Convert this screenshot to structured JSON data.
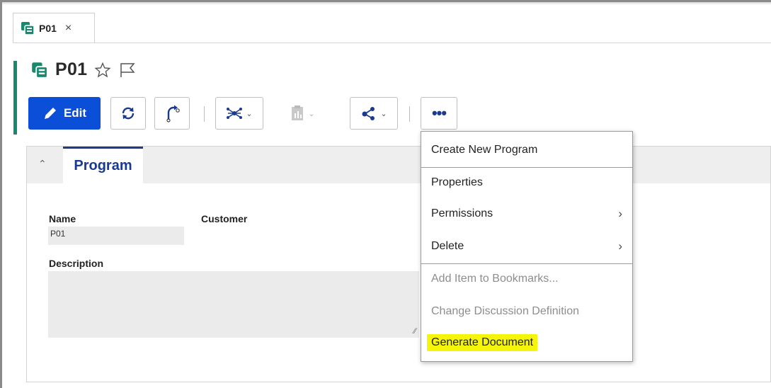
{
  "tab": {
    "label": "P01",
    "close": "×"
  },
  "title": {
    "text": "P01"
  },
  "toolbar": {
    "edit_label": "Edit",
    "more_label": "•••"
  },
  "section": {
    "tab_label": "Program"
  },
  "form": {
    "name_label": "Name",
    "name_value": "P01",
    "customer_label": "Customer",
    "description_label": "Description",
    "description_value": ""
  },
  "menu": {
    "items": [
      {
        "label": "Create New Program",
        "submenu": false,
        "enabled": true
      },
      {
        "label": "Properties",
        "submenu": false,
        "enabled": true
      },
      {
        "label": "Permissions",
        "submenu": true,
        "enabled": true
      },
      {
        "label": "Delete",
        "submenu": true,
        "enabled": true
      },
      {
        "label": "Add Item to Bookmarks...",
        "submenu": false,
        "enabled": false
      },
      {
        "label": "Change Discussion Definition",
        "submenu": false,
        "enabled": false
      },
      {
        "label": "Generate Document",
        "submenu": false,
        "enabled": true,
        "highlighted": true
      }
    ]
  },
  "colors": {
    "accent_green": "#17896f",
    "edit_blue": "#0b4ed8",
    "tab_blue": "#1a3a8f",
    "highlight_yellow": "#f5f50a"
  },
  "icons": [
    "program-icon",
    "star-icon",
    "flag-icon",
    "pencil-icon",
    "refresh-icon",
    "promote-icon",
    "structure-icon",
    "report-icon",
    "share-icon",
    "more-icon",
    "chevron-up-icon",
    "chevron-right-icon"
  ]
}
